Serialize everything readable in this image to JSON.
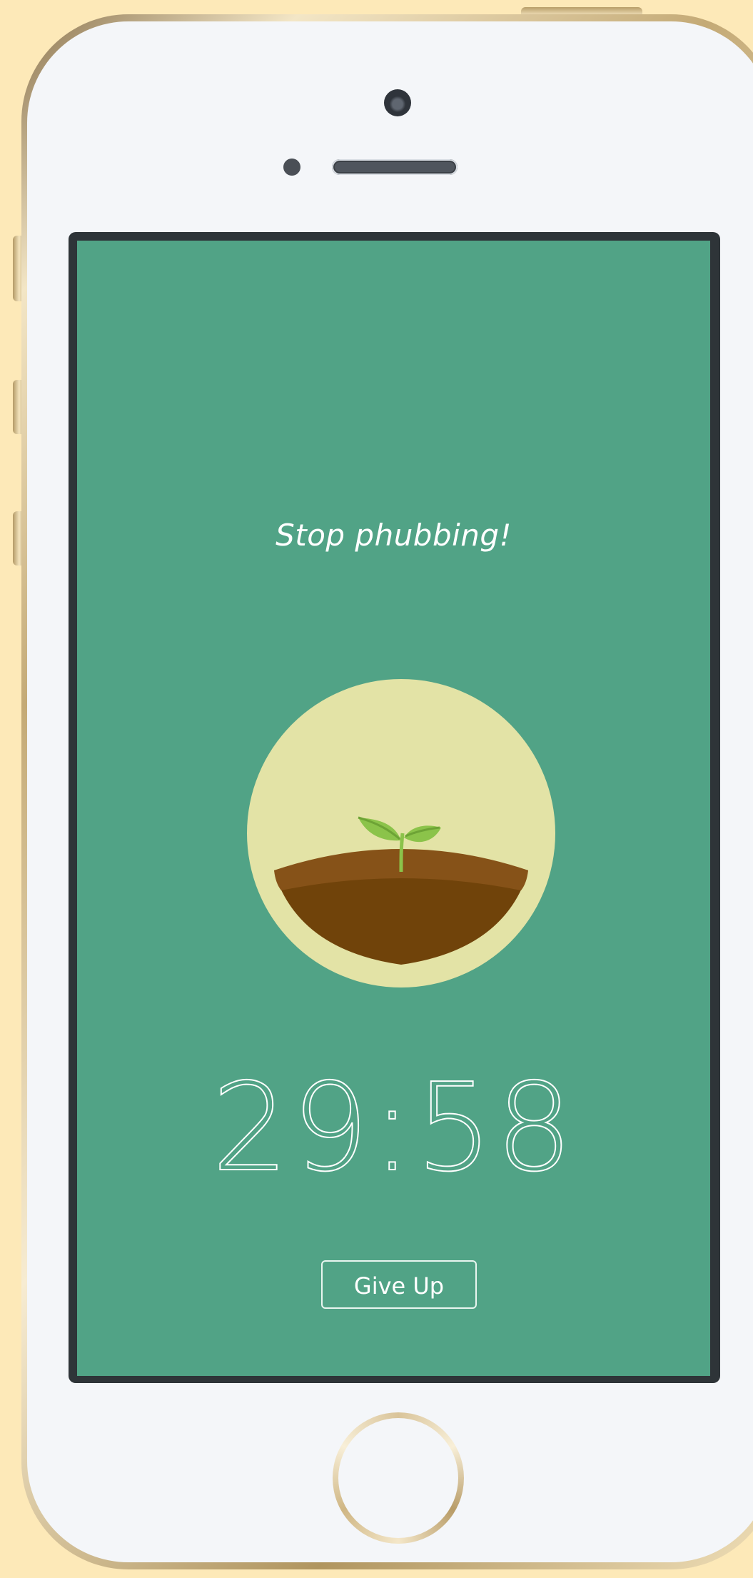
{
  "app": {
    "motto": "Stop phubbing!",
    "timer": "29:58",
    "give_up_label": "Give Up"
  },
  "colors": {
    "background": "#fde9b8",
    "screen": "#51a386",
    "circle": "#e3e3a6",
    "soil": "#70430a",
    "soil_top": "#865218",
    "leaf": "#8bc34a"
  },
  "icons": {
    "sprout": "sprout-in-soil-icon"
  }
}
